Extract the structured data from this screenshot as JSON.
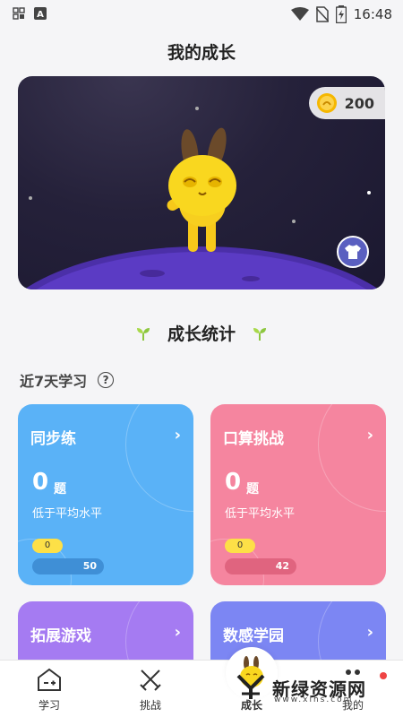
{
  "status_bar": {
    "time": "16:48"
  },
  "page": {
    "title": "我的成长"
  },
  "hero": {
    "coins": "200"
  },
  "stats": {
    "title": "成长统计",
    "period_label": "近7天学习",
    "help_icon": "?"
  },
  "cards": [
    {
      "title": "同步练",
      "count": "0",
      "unit": "题",
      "level": "低于平均水平",
      "badge": "0",
      "bar_value": "50",
      "color": "#5ab2f7"
    },
    {
      "title": "口算挑战",
      "count": "0",
      "unit": "题",
      "level": "低于平均水平",
      "badge": "0",
      "bar_value": "42",
      "color": "#f5859f"
    },
    {
      "title": "拓展游戏",
      "color": "#a57bf2"
    },
    {
      "title": "数感学园",
      "color": "#7c86f3"
    }
  ],
  "tabbar": {
    "items": [
      {
        "label": "学习",
        "icon": "study-icon"
      },
      {
        "label": "挑战",
        "icon": "swords-icon"
      },
      {
        "label": "成长",
        "icon": "mascot-icon",
        "active": true
      },
      {
        "label": "我的",
        "icon": "profile-icon"
      }
    ]
  },
  "watermark": {
    "main": "新绿资源网",
    "sub": "www.xlhs.com"
  }
}
